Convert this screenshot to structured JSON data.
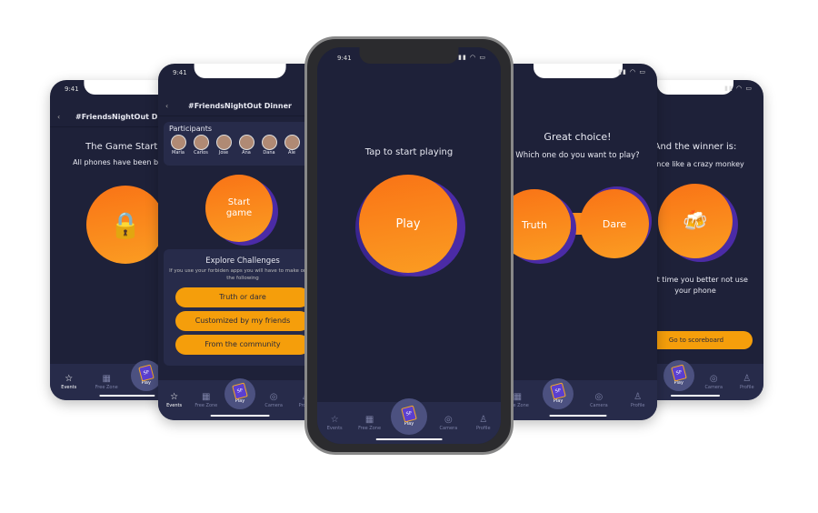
{
  "status_time": "9:41",
  "nav": {
    "events": "Events",
    "free_zone": "Free Zone",
    "play": "Play",
    "camera": "Camera",
    "profile": "Profile",
    "logo": "SP"
  },
  "screen1": {
    "header": "#FriendsNightOut Dinner",
    "title": "The Game Started",
    "subtitle": "All phones have been blocked"
  },
  "screen2": {
    "header": "#FriendsNightOut Dinner",
    "participants_label": "Participants",
    "participants": [
      "Maria",
      "Carlos",
      "Jose",
      "Ana",
      "Dana",
      "Ale"
    ],
    "start_button": "Start game",
    "explore_title": "Explore Challenges",
    "explore_text": "If you use your forbiden apps you will have to make one of the following",
    "options": [
      "Truth or dare",
      "Customized by my friends",
      "From the community"
    ]
  },
  "screen3": {
    "prompt": "Tap to start playing",
    "play_button": "Play"
  },
  "screen4": {
    "title": "Great choice!",
    "subtitle": "Which one do you want to play?",
    "truth": "Truth",
    "dare": "Dare"
  },
  "screen5": {
    "title": "And the winner is:",
    "subtitle": "Dance like a crazy monkey",
    "message": "Next time you better not use your phone",
    "button": "Go to scoreboard"
  },
  "colors": {
    "screen_bg": "#1e2139",
    "nav_bg": "#272b4a",
    "orange": "#f97316",
    "purple": "#4b2ba6",
    "button": "#f59e0b"
  }
}
